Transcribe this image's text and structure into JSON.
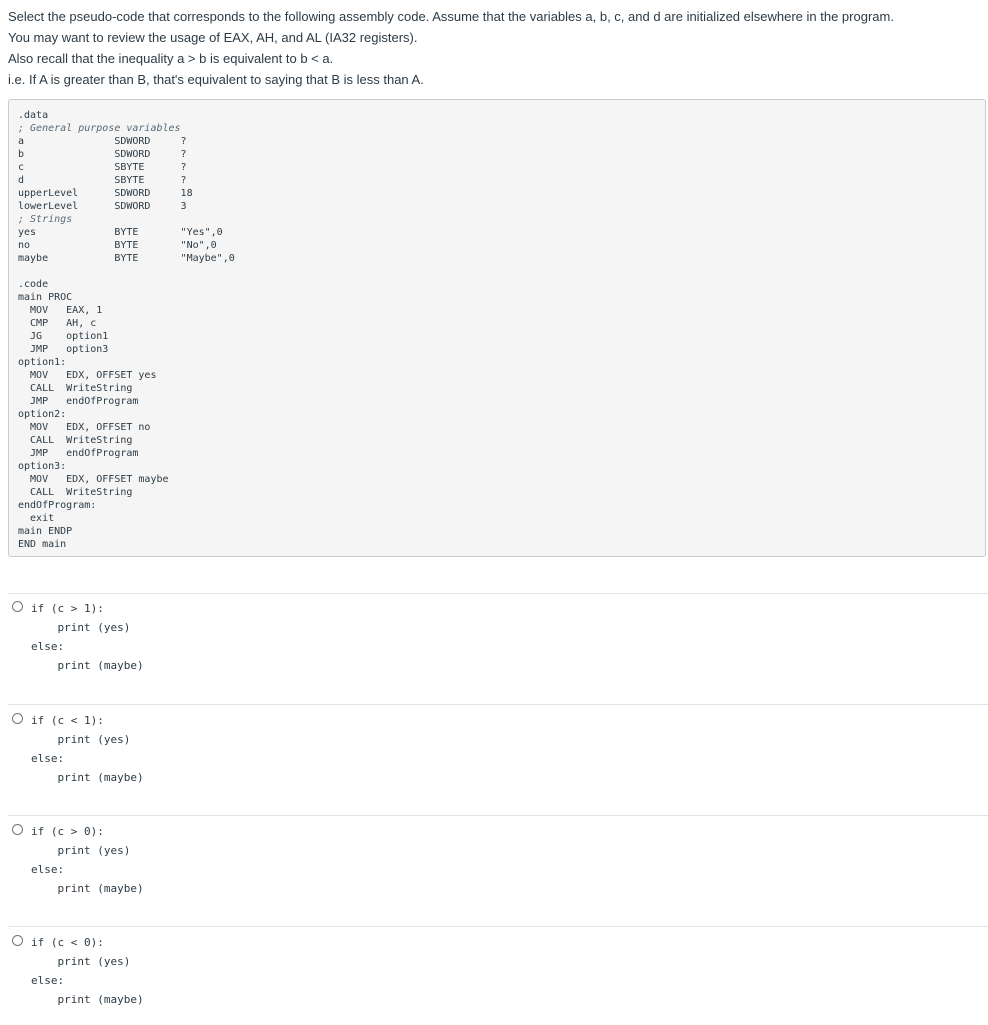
{
  "question": {
    "lines": [
      "Select the pseudo-code that corresponds to the following assembly code. Assume that the variables a, b, c, and d are initialized elsewhere in the program.",
      "You may want to review the usage of EAX, AH, and AL (IA32 registers).",
      "Also recall that the inequality a > b is equivalent to b < a.",
      "i.e. If A is greater than B, that's equivalent to saying that B is less than A."
    ]
  },
  "assembly": {
    "data_section": [
      ".data",
      "; General purpose variables",
      "a               SDWORD     ?",
      "b               SDWORD     ?",
      "c               SBYTE      ?",
      "d               SBYTE      ?",
      "upperLevel      SDWORD     18",
      "lowerLevel      SDWORD     3",
      "; Strings",
      "yes             BYTE       \"Yes\",0",
      "no              BYTE       \"No\",0",
      "maybe           BYTE       \"Maybe\",0"
    ],
    "code_section": [
      ".code",
      "main PROC",
      "  MOV   EAX, 1",
      "  CMP   AH, c",
      "  JG    option1",
      "  JMP   option3",
      "option1:",
      "  MOV   EDX, OFFSET yes",
      "  CALL  WriteString",
      "  JMP   endOfProgram",
      "option2:",
      "  MOV   EDX, OFFSET no",
      "  CALL  WriteString",
      "  JMP   endOfProgram",
      "option3:",
      "  MOV   EDX, OFFSET maybe",
      "  CALL  WriteString",
      "endOfProgram:",
      "  exit",
      "main ENDP",
      "END main"
    ]
  },
  "answers": [
    {
      "condition": "if (c > 1):",
      "then": "print (yes)",
      "else": "else:",
      "otherwise": "print (maybe)"
    },
    {
      "condition": "if (c < 1):",
      "then": "print (yes)",
      "else": "else:",
      "otherwise": "print (maybe)"
    },
    {
      "condition": "if (c > 0):",
      "then": "print (yes)",
      "else": "else:",
      "otherwise": "print (maybe)"
    },
    {
      "condition": "if (c < 0):",
      "then": "print (yes)",
      "else": "else:",
      "otherwise": "print (maybe)"
    }
  ]
}
